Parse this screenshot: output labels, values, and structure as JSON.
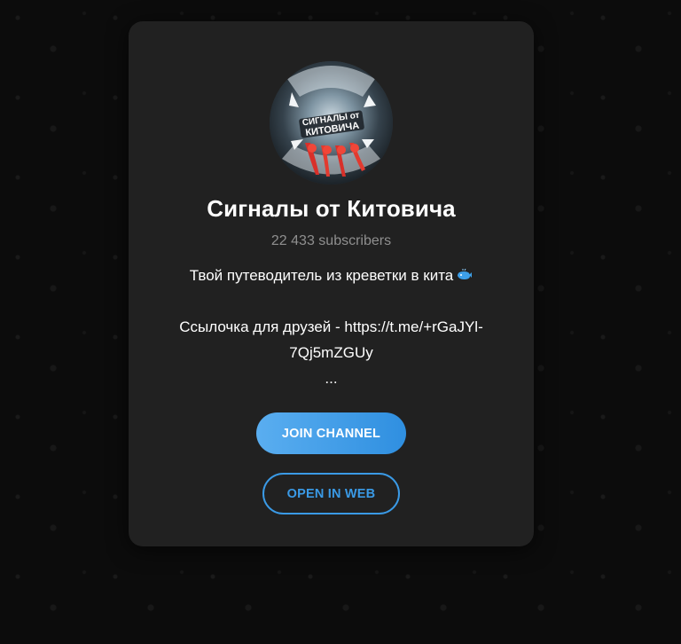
{
  "channel": {
    "name": "Сигналы от Китовича",
    "subscribers": "22 433 subscribers",
    "avatar_text": "Сигналы от Китовича",
    "description": {
      "line1": "Твой путеводитель из креветки в кита",
      "line1_emoji": "whale-icon",
      "line2": "Ссылочка для друзей - https://t.me/+rGaJYl-",
      "line3": "7Qj5mZGUy",
      "line4": "..."
    }
  },
  "buttons": {
    "join": "JOIN CHANNEL",
    "open_web": "OPEN IN WEB"
  },
  "colors": {
    "card_bg": "#212121",
    "accent": "#3a9ae6",
    "subtle_text": "#8f8f8f"
  }
}
